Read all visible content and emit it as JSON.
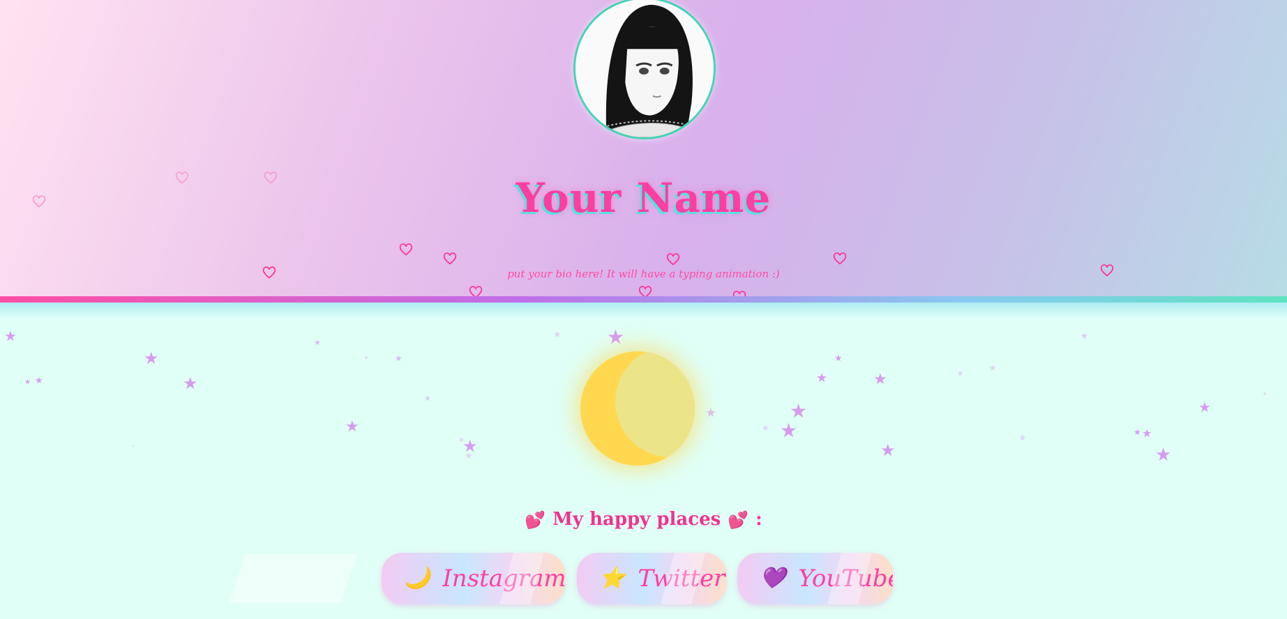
{
  "profile": {
    "name": "Your Name",
    "bio": "put your bio here! It will have a typing animation :)"
  },
  "places": {
    "title": "My happy places",
    "title_suffix": ":",
    "title_emoji": "💕",
    "links": [
      {
        "label": "Instagram",
        "icon": "🌙",
        "icon_name": "crescent-moon-icon"
      },
      {
        "label": "Twitter",
        "icon": "⭐",
        "icon_name": "star-icon"
      },
      {
        "label": "YouTube",
        "icon": "💜",
        "icon_name": "purple-heart-icon"
      }
    ]
  },
  "colors": {
    "accent_pink": "#ff3ea2",
    "accent_teal": "#3fd6b6",
    "moon_yellow": "#ffd84f",
    "star_purple": "#d69bf0",
    "lower_background": "#e0fff6"
  }
}
